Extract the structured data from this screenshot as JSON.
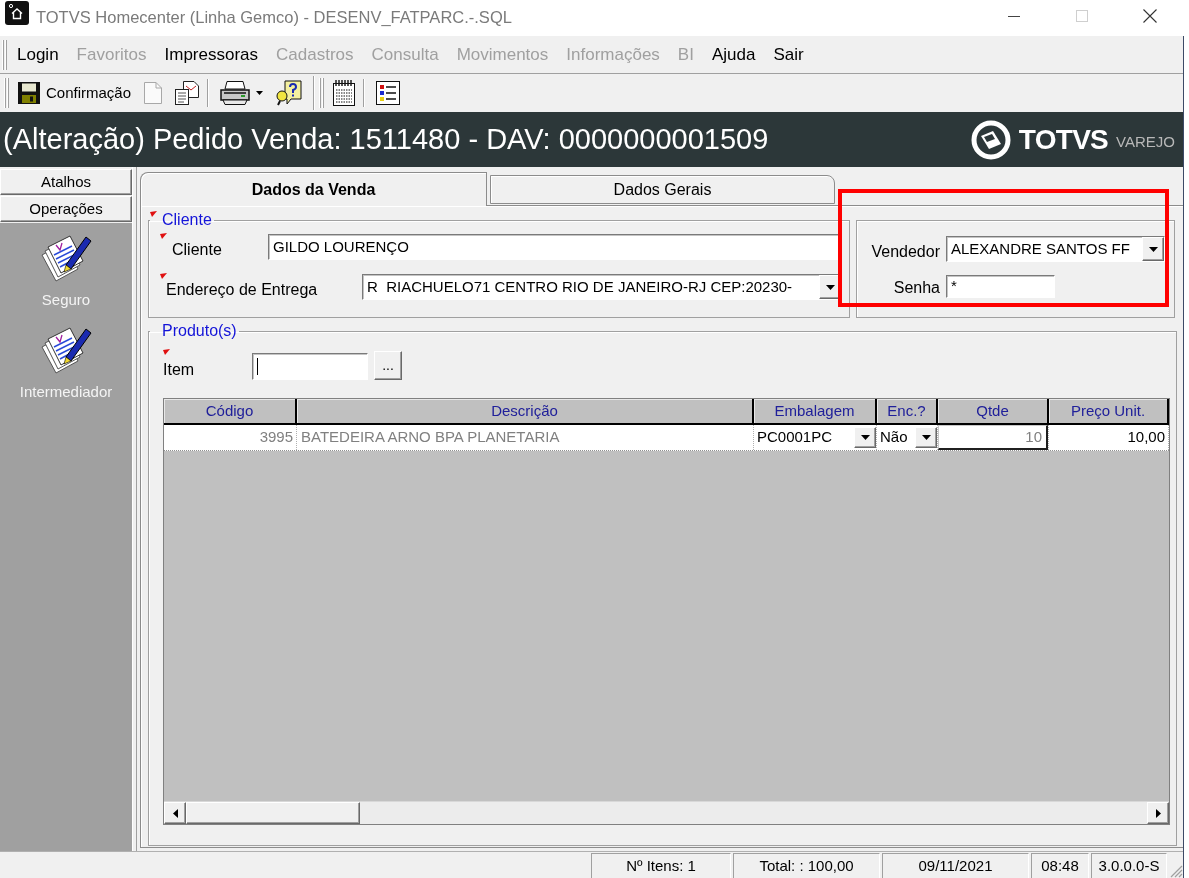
{
  "window": {
    "title": "TOTVS Homecenter (Linha Gemco) - DESENV_FATPARC.-.SQL"
  },
  "menu": [
    {
      "label": "Login",
      "disabled": false
    },
    {
      "label": "Favoritos",
      "disabled": true
    },
    {
      "label": "Impressoras",
      "disabled": false
    },
    {
      "label": "Cadastros",
      "disabled": true
    },
    {
      "label": "Consulta",
      "disabled": true
    },
    {
      "label": "Movimentos",
      "disabled": true
    },
    {
      "label": "Informações",
      "disabled": true
    },
    {
      "label": "BI",
      "disabled": true
    },
    {
      "label": "Ajuda",
      "disabled": false
    },
    {
      "label": "Sair",
      "disabled": false
    }
  ],
  "toolbar": [
    {
      "band_start": true,
      "buttons": [
        {
          "kind": "save",
          "label": "Confirmação",
          "disabled": false
        },
        {
          "kind": "new",
          "disabled": true
        },
        {
          "kind": "documents",
          "disabled": false
        }
      ]
    },
    {
      "band_start": false,
      "buttons": [
        {
          "kind": "print",
          "disabled": false
        },
        {
          "kind": "help",
          "disabled": false
        }
      ]
    },
    {
      "band_start": true,
      "buttons": [
        {
          "kind": "notepad",
          "disabled": false
        }
      ]
    },
    {
      "band_start": false,
      "buttons": [
        {
          "kind": "list",
          "disabled": false
        }
      ]
    }
  ],
  "header": {
    "title": "(Alteração) Pedido Venda: 1511480 - DAV: 0000000001509",
    "logo": {
      "brand": "TOTVS",
      "product": "VAREJO"
    }
  },
  "sidebar": {
    "sections": [
      {
        "label": "Atalhos"
      },
      {
        "label": "Operações"
      }
    ],
    "shortcuts": [
      {
        "label": "Seguro"
      },
      {
        "label": "Intermediador"
      }
    ]
  },
  "tabs": [
    {
      "label": "Dados da Venda",
      "selected": true
    },
    {
      "label": "Dados Gerais",
      "selected": false
    }
  ],
  "cliente": {
    "title": "Cliente",
    "required": true,
    "fields": [
      {
        "kind": "text",
        "label": "Cliente",
        "value": "GILDO LOURENÇO",
        "required": true
      },
      {
        "kind": "combo",
        "label": "Endereço de Entrega",
        "value": "R  RIACHUELO71 CENTRO RIO DE JANEIRO-RJ CEP:20230-",
        "required": true
      }
    ]
  },
  "vendedor": {
    "fields": [
      {
        "kind": "combo",
        "label": "Vendedor",
        "value": "ALEXANDRE SANTOS FF",
        "required": false
      },
      {
        "kind": "text",
        "label": "Senha",
        "value": "*",
        "required": false
      }
    ]
  },
  "produtos": {
    "title": "Produto(s)",
    "required": false,
    "item": {
      "label": "Item",
      "required": true,
      "focused": true,
      "lookup": "..."
    },
    "table": {
      "columns": [
        {
          "label": "Código",
          "kind": "code"
        },
        {
          "label": "Descrição",
          "kind": "text"
        },
        {
          "label": "Embalagem",
          "kind": "combo"
        },
        {
          "label": "Enc.?",
          "kind": "combo"
        },
        {
          "label": "Qtde",
          "kind": "input"
        },
        {
          "label": "Preço Unit.",
          "kind": "number"
        }
      ],
      "rows": [
        [
          "3995",
          "BATEDEIRA ARNO BPA PLANETARIA",
          "PC0001PC",
          "Não",
          "10",
          "10,00"
        ]
      ]
    }
  },
  "status_bar": [
    "Nº Itens: 1",
    "Total: : 100,00",
    "09/11/2021",
    "08:48",
    "3.0.0.0-S"
  ]
}
